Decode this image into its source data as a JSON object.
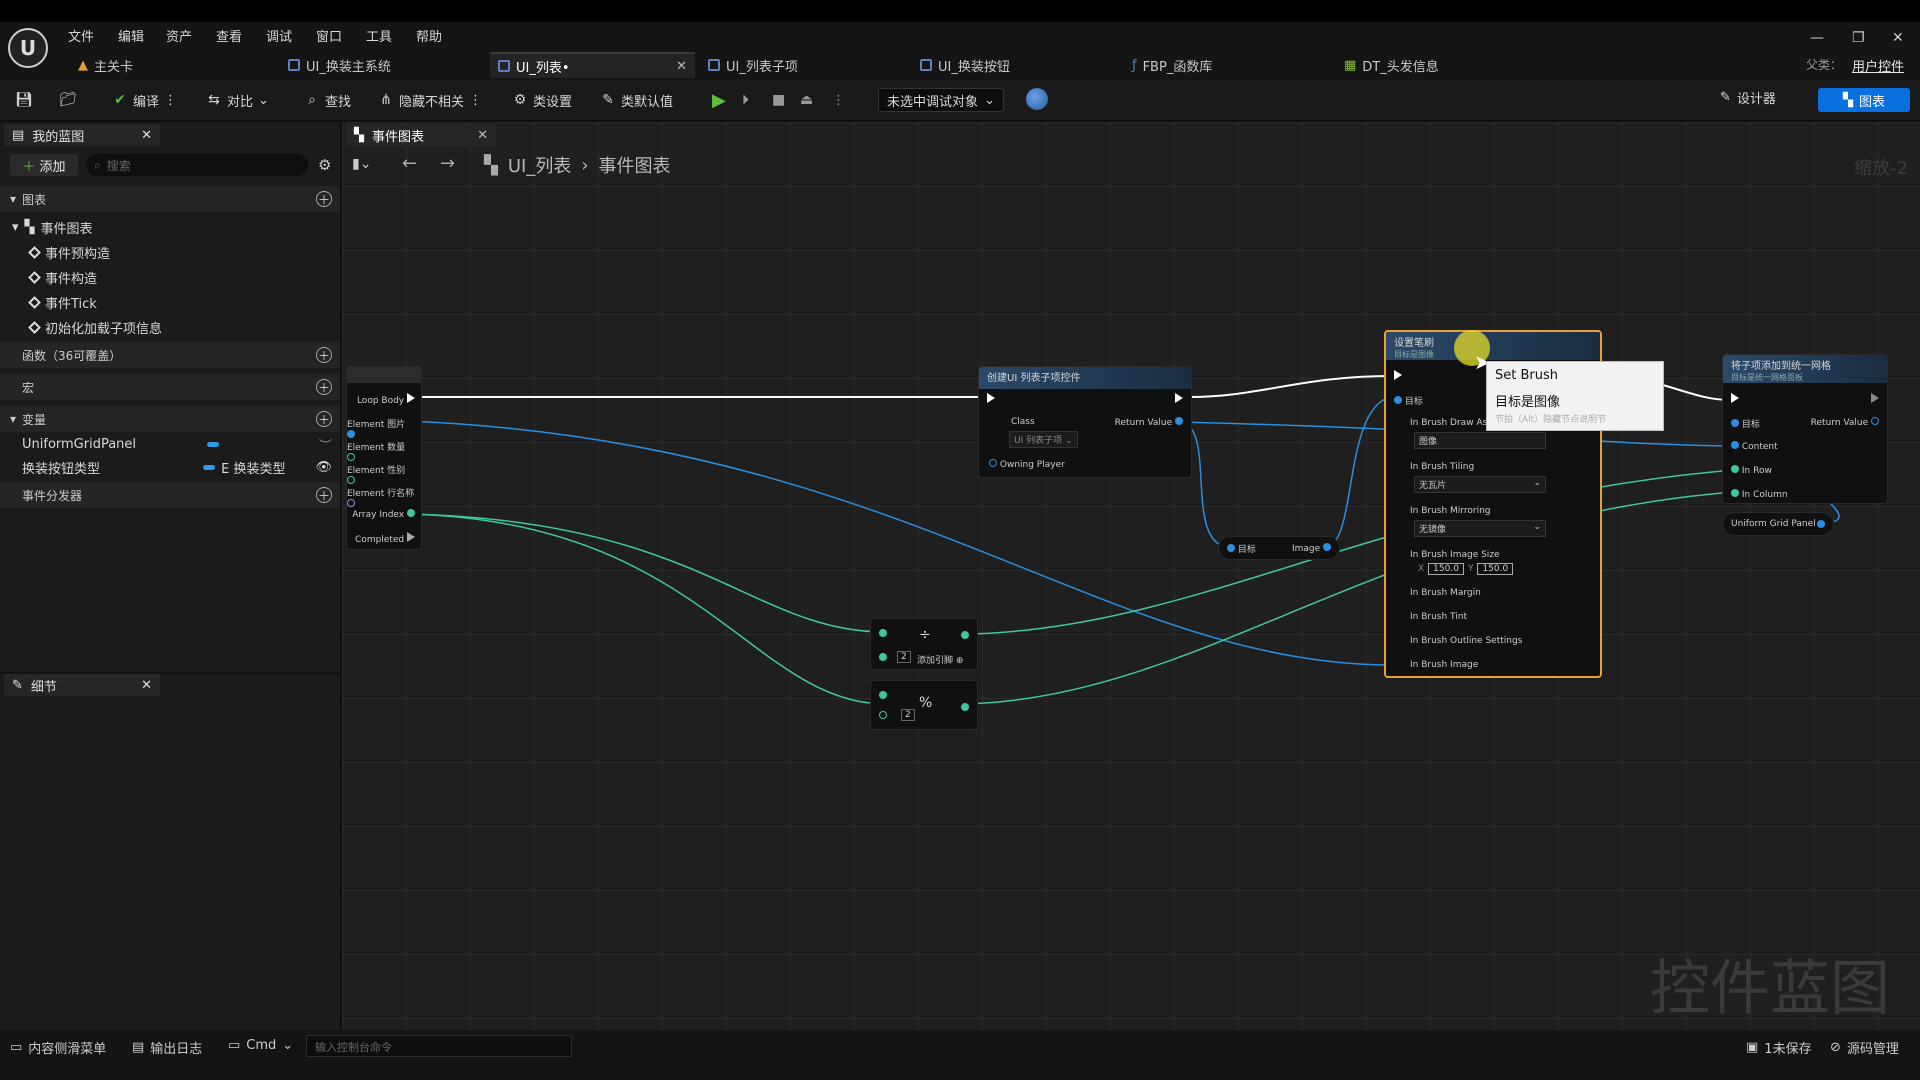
{
  "menu": [
    "文件",
    "编辑",
    "资产",
    "查看",
    "调试",
    "窗口",
    "工具",
    "帮助"
  ],
  "tabs": [
    {
      "label": "主关卡",
      "active": false
    },
    {
      "label": "UI_换装主系统",
      "active": false
    },
    {
      "label": "UI_列表•",
      "active": true
    },
    {
      "label": "UI_列表子项",
      "active": false
    },
    {
      "label": "UI_换装按钮",
      "active": false
    },
    {
      "label": "FBP_函数库",
      "active": false
    },
    {
      "label": "DT_头发信息",
      "active": false
    }
  ],
  "parent_class": {
    "label": "父类：",
    "value": "用户控件"
  },
  "toolbar": {
    "compile": "编译",
    "diff": "对比",
    "find": "查找",
    "hide_unrelated": "隐藏不相关",
    "class_settings": "类设置",
    "class_defaults": "类默认值",
    "debug_target": "未选中调试对象",
    "designer": "设计器",
    "graph": "图表"
  },
  "my_blueprint": {
    "tab": "我的蓝图",
    "add": "添加",
    "search_placeholder": "搜索",
    "graphs_section": "图表",
    "event_graph": "事件图表",
    "events": [
      "事件预构造",
      "事件构造",
      "事件Tick",
      "初始化加载子项信息"
    ],
    "functions_section": "函数（36可覆盖）",
    "macros_section": "宏",
    "variables_section": "变量",
    "variables": [
      {
        "name": "UniformGridPanel",
        "type": ""
      },
      {
        "name": "换装按钮类型",
        "type": "E 换装类型"
      }
    ],
    "dispatchers_section": "事件分发器"
  },
  "details": {
    "tab": "细节"
  },
  "graph": {
    "tab": "事件图表",
    "breadcrumb": [
      "UI_列表",
      "事件图表"
    ],
    "zoom": "缩放-2",
    "watermark": "控件蓝图"
  },
  "nodes": {
    "loop": {
      "pins": [
        "Loop Body",
        "Element 图片",
        "Element 数量",
        "Element 性别",
        "Element 行名称",
        "Array Index",
        "Completed"
      ]
    },
    "create_widget": {
      "title": "创建UI 列表子项控件",
      "class_pin": "Class",
      "class_value": "UI 列表子项",
      "return_pin": "Return Value",
      "owning_player": "Owning Player"
    },
    "image_getter": {
      "target": "目标",
      "output": "Image"
    },
    "divide": {
      "symbol": "÷",
      "value": "2",
      "add_pin": "添加引脚"
    },
    "modulo": {
      "symbol": "%",
      "value": "2"
    },
    "set_brush": {
      "title": "设置笔刷",
      "subtitle": "目标是图像",
      "target": "目标",
      "draw_as": "In Brush Draw As",
      "draw_as_value": "图像",
      "tiling": "In Brush Tiling",
      "tiling_value": "无瓦片",
      "mirroring": "In Brush Mirroring",
      "mirroring_value": "无镜像",
      "image_size": "In Brush Image Size",
      "size_x_label": "X",
      "size_x": "150.0",
      "size_y_label": "Y",
      "size_y": "150.0",
      "margin": "In Brush Margin",
      "tint": "In Brush Tint",
      "outline": "In Brush Outline Settings",
      "image": "In Brush Image"
    },
    "add_to_grid": {
      "title": "将子项添加到统一网格",
      "subtitle": "目标是统一网格面板",
      "target": "目标",
      "return_pin": "Return Value",
      "content": "Content",
      "row": "In Row",
      "column": "In Column"
    },
    "grid_var": {
      "label": "Uniform Grid Panel"
    }
  },
  "tooltip": {
    "title": "Set Brush",
    "subtitle": "目标是图像",
    "hint": "节拍（Alt）隐藏节点说明节"
  },
  "status": {
    "content_drawer": "内容侧滑菜单",
    "output_log": "输出日志",
    "cmd": "Cmd",
    "console_placeholder": "输入控制台命令",
    "unsaved": "1未保存",
    "source_control": "源码管理"
  }
}
